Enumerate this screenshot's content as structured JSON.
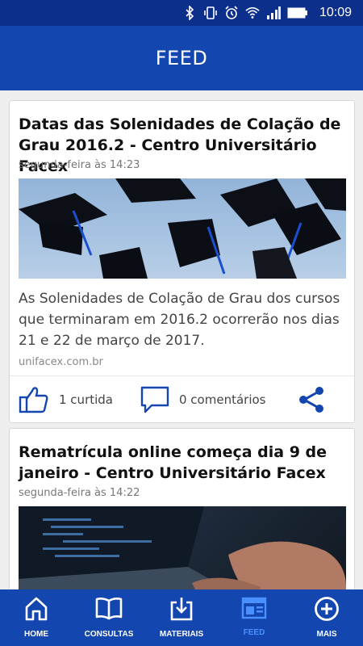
{
  "status_bar": {
    "time": "10:09",
    "icons": [
      "bluetooth-icon",
      "vibrate-icon",
      "alarm-icon",
      "wifi-icon",
      "signal-icon",
      "battery-icon"
    ]
  },
  "app_bar": {
    "title": "FEED"
  },
  "feed": {
    "posts": [
      {
        "title": "Datas das Solenidades de Colação de Grau 2016.2 - Centro Universitário Facex",
        "date": "segunda-feira às 14:23",
        "image": "graduation-caps-image",
        "body": "As Solenidades de Colação de Grau dos cursos que terminaram em 2016.2 ocorrerão nos dias 21 e 22 de março de 2017.",
        "source": "unifacex.com.br",
        "likes": "1 curtida",
        "comments": "0 comentários"
      },
      {
        "title": "Rematrícula online começa dia 9 de janeiro - Centro Universitário Facex",
        "date": "segunda-feira às 14:22",
        "image": "laptop-typing-image"
      }
    ]
  },
  "bottom_nav": {
    "items": [
      {
        "label": "HOME",
        "icon": "home-icon",
        "active": false
      },
      {
        "label": "CONSULTAS",
        "icon": "book-icon",
        "active": false
      },
      {
        "label": "MATERIAIS",
        "icon": "download-icon",
        "active": false
      },
      {
        "label": "FEED",
        "icon": "feed-icon",
        "active": true
      },
      {
        "label": "MAIS",
        "icon": "plus-circle-icon",
        "active": false
      }
    ]
  },
  "colors": {
    "status_bar": "#0d2f8c",
    "app_bar": "#1446b0",
    "nav_active": "#4a90ff",
    "icon_accent": "#1446b0"
  }
}
